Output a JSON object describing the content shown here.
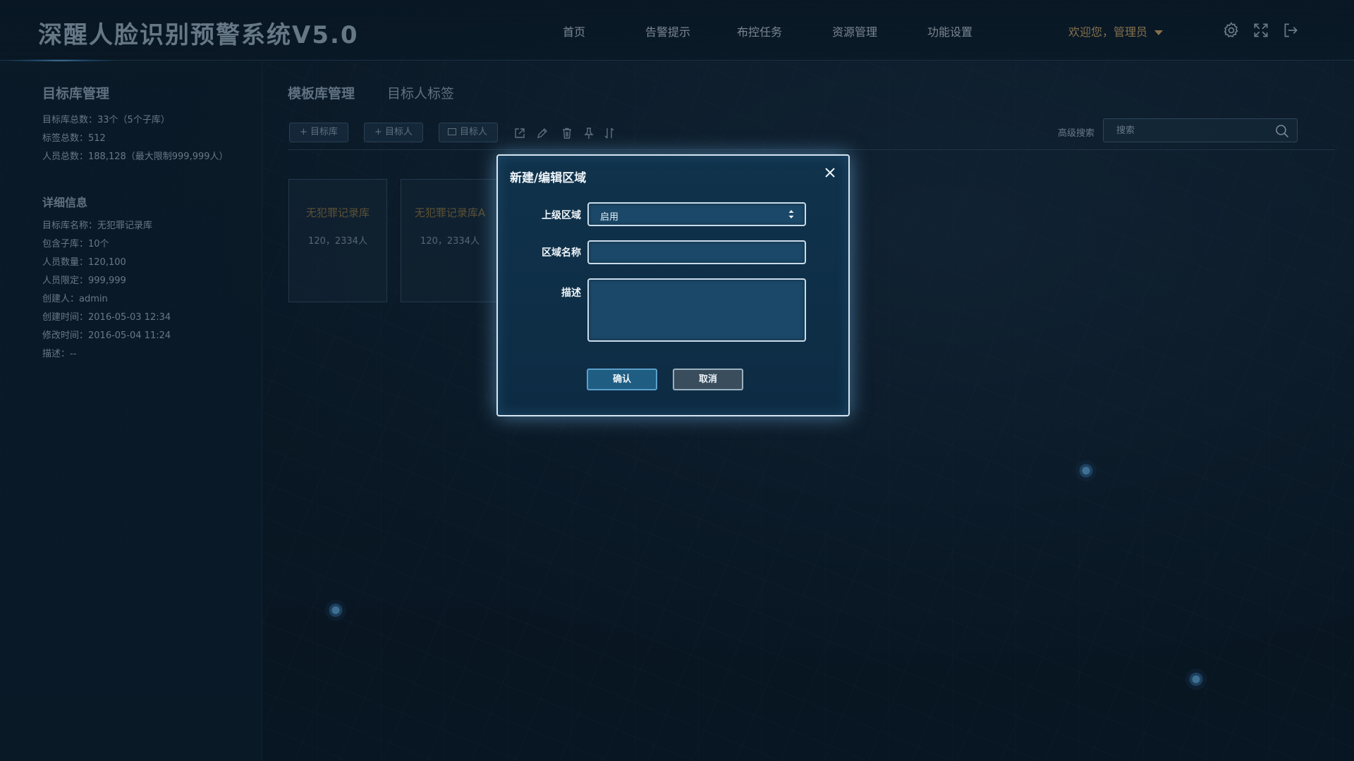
{
  "app": {
    "title": "深醒人脸识别预警系统V5.0"
  },
  "nav": {
    "items": [
      {
        "label": "首页"
      },
      {
        "label": "告警提示"
      },
      {
        "label": "布控任务"
      },
      {
        "label": "资源管理"
      },
      {
        "label": "功能设置"
      }
    ],
    "user": "欢迎您，管理员"
  },
  "sidebar": {
    "title": "目标库管理",
    "stats": [
      "目标库总数：33个（5个子库）",
      "标签总数：512",
      "人员总数：188,128（最大限制999,999人）"
    ],
    "detail_title": "详细信息",
    "details": [
      "目标库名称：无犯罪记录库",
      "包含子库：10个",
      "人员数量：120,100",
      "人员限定：999,999",
      "创建人：admin",
      "创建时间：2016-05-03 12:34",
      "修改时间：2016-05-04 11:24",
      "描述：--"
    ]
  },
  "tabs": [
    {
      "label": "模板库管理",
      "active": true
    },
    {
      "label": "目标人标签",
      "active": false
    }
  ],
  "toolbar": {
    "add_library": "+ 目标库",
    "add_person": "+ 目标人",
    "copy_person": "目标人",
    "icons": [
      "export-icon",
      "edit-icon",
      "delete-icon",
      "pin-icon",
      "sort-icon"
    ],
    "advanced_search": "高级搜索",
    "search_placeholder": "搜索"
  },
  "cards": [
    {
      "name": "无犯罪记录库",
      "count": "120，2334人"
    },
    {
      "name": "无犯罪记录库A",
      "count": "120，2334人"
    }
  ],
  "modal": {
    "title": "新建/编辑区域",
    "parent_label": "上级区域",
    "parent_value": "启用",
    "name_label": "区域名称",
    "name_value": "",
    "desc_label": "描述",
    "desc_value": "",
    "confirm": "确认",
    "cancel": "取消"
  },
  "colors": {
    "accent_gold": "#c9a56a",
    "modal_border": "#d7e6f1",
    "confirm_bg": "#1f5d82"
  }
}
